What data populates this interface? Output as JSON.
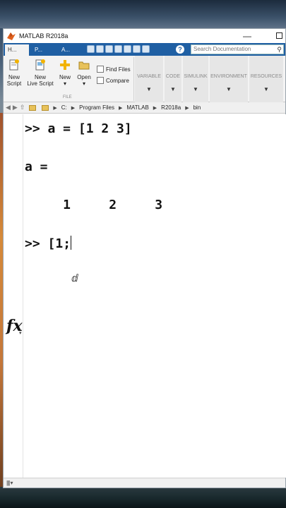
{
  "window": {
    "title": "MATLAB R2018a",
    "min_glyph": "—"
  },
  "tabs": [
    {
      "label": "H..."
    },
    {
      "label": "P..."
    },
    {
      "label": "A..."
    }
  ],
  "search": {
    "placeholder": "Search Documentation"
  },
  "ribbon": {
    "new_script": {
      "line1": "New",
      "line2": "Script"
    },
    "new_live_script": {
      "line1": "New",
      "line2": "Live Script"
    },
    "new": {
      "label": "New"
    },
    "open": {
      "label": "Open"
    },
    "find_files": "Find Files",
    "compare": "Compare",
    "file_group": "FILE",
    "groups": [
      "VARIABLE",
      "CODE",
      "SIMULINK",
      "ENVIRONMENT",
      "RESOURCES"
    ]
  },
  "address": {
    "path": [
      "C:",
      "Program Files",
      "MATLAB",
      "R2018a",
      "bin"
    ]
  },
  "command_window": {
    "line1": ">> a = [1 2 3]",
    "line2": "a =",
    "line3": "     1     2     3",
    "prompt": ">> ",
    "current_input": "[1;",
    "fx_label": "fx"
  },
  "icons": {
    "matlab_logo": "matlab-logo-icon",
    "search": "search-icon",
    "help": "help-icon"
  }
}
